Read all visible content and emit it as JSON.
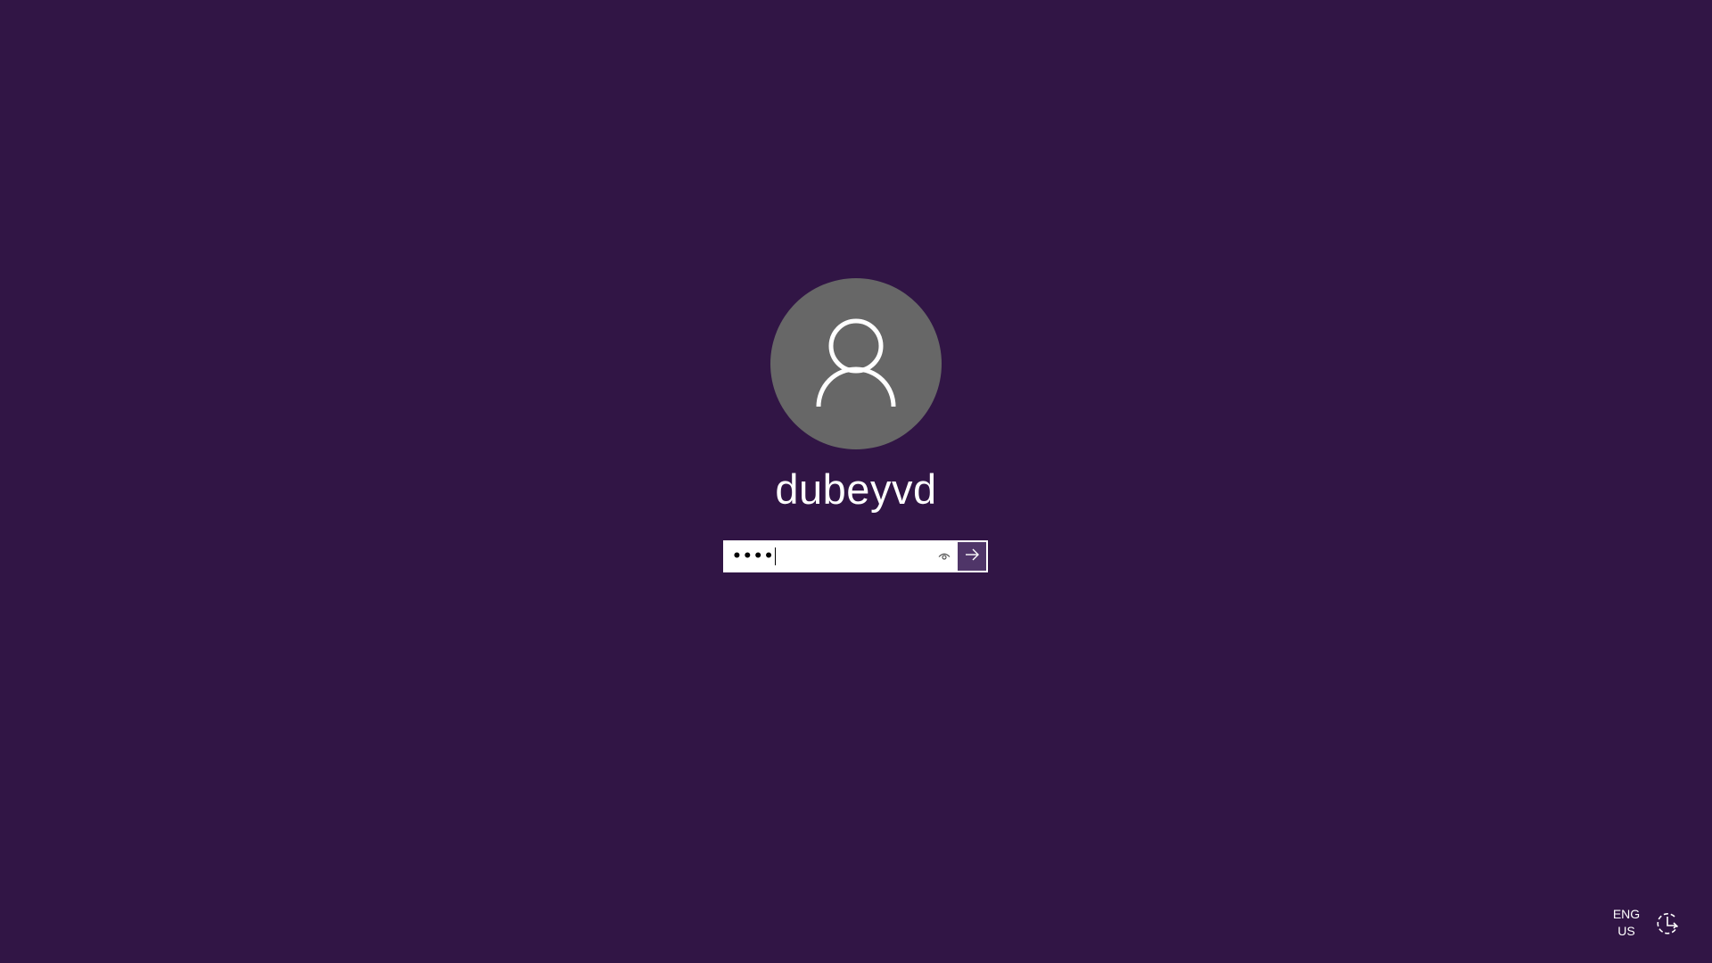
{
  "user": {
    "name": "dubeyvd",
    "avatar_icon": "user-silhouette-icon"
  },
  "password": {
    "masked_value": "••••",
    "reveal_icon": "eye-icon",
    "submit_icon": "arrow-right-icon"
  },
  "system_tray": {
    "language_line1": "ENG",
    "language_line2": "US",
    "ease_of_access_icon": "ease-of-access-icon"
  },
  "colors": {
    "background": "#311545",
    "avatar_bg": "#676767",
    "submit_bg": "#4f3568",
    "text": "#ffffff"
  }
}
